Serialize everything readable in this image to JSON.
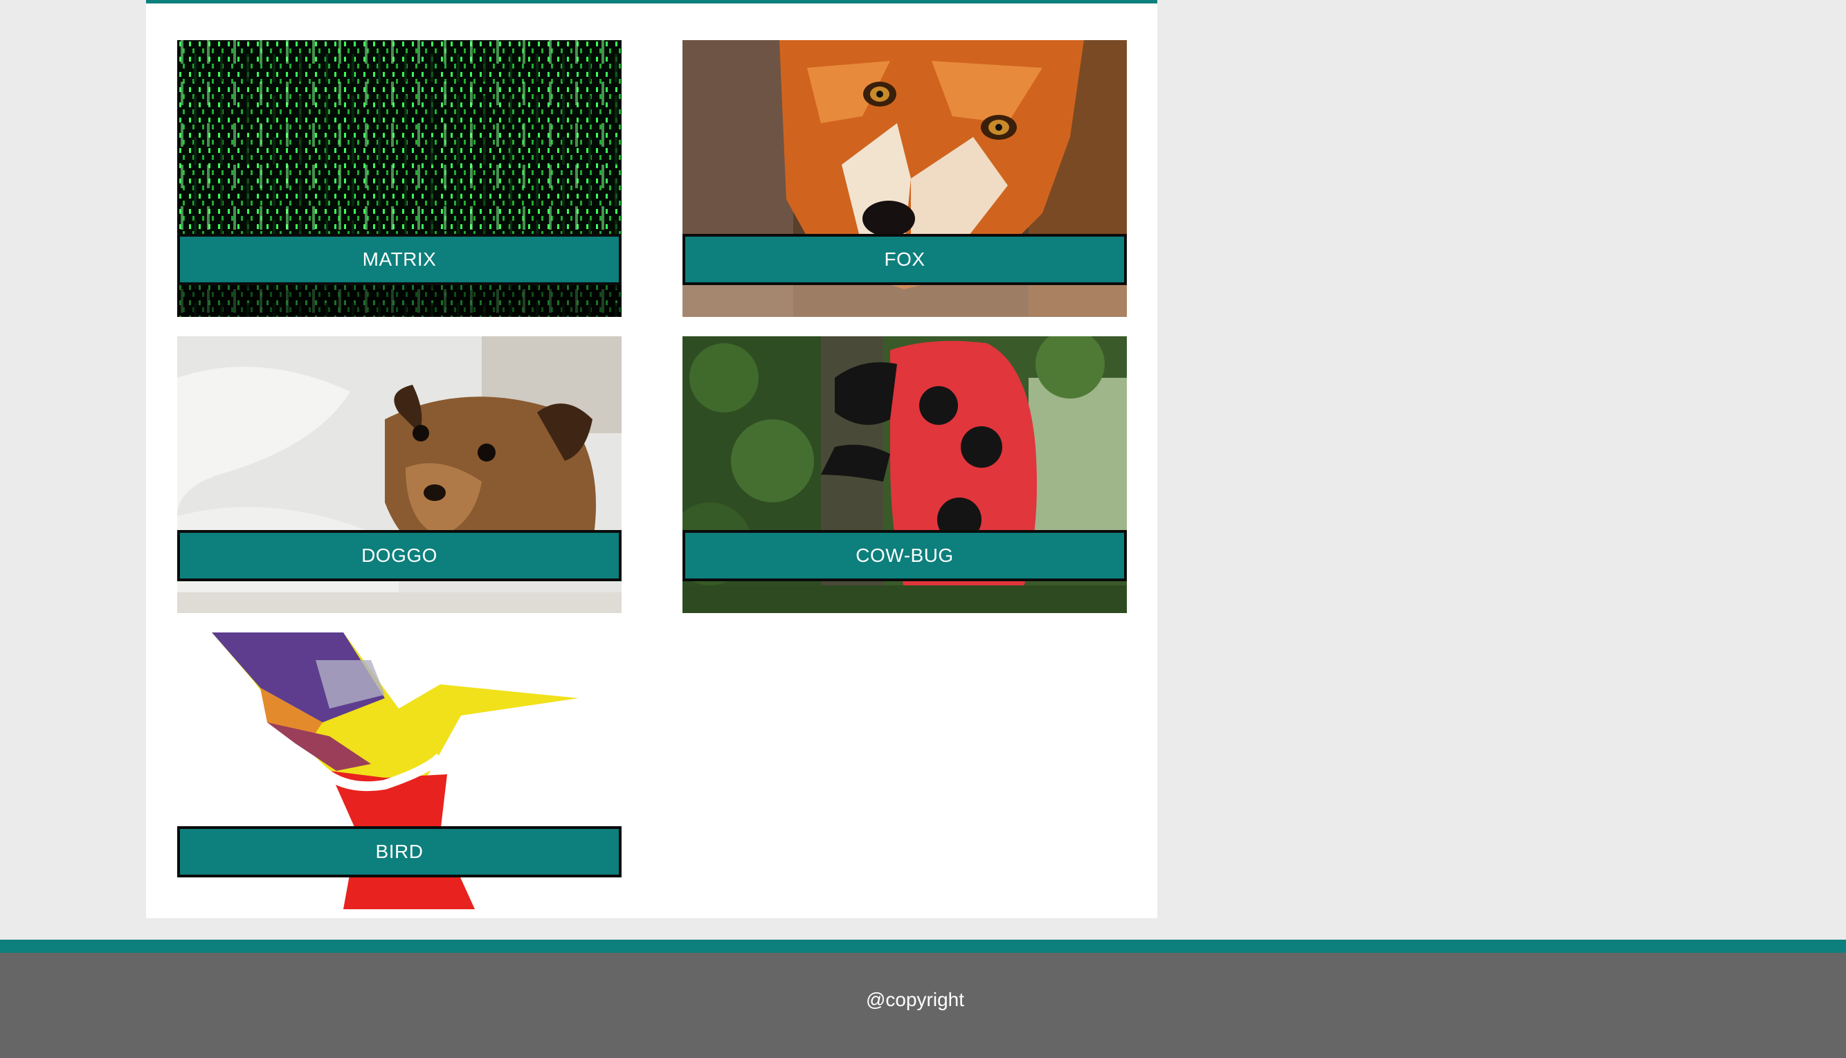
{
  "gallery": {
    "cards": [
      {
        "label": "MATRIX",
        "image": "matrix-code-image"
      },
      {
        "label": "FOX",
        "image": "fox-face-photo"
      },
      {
        "label": "DOGGO",
        "image": "dog-photo"
      },
      {
        "label": "COW-BUG",
        "image": "ladybug-cow-statue-photo"
      },
      {
        "label": "BIRD",
        "image": "colorful-bird-graphic"
      }
    ]
  },
  "footer": {
    "copyright": "@copyright"
  },
  "colors": {
    "accent": "#0d7f7c",
    "page_background": "#ebebeb",
    "panel_background": "#ffffff",
    "footer_background": "#666666",
    "caption_text": "#ffffff"
  }
}
